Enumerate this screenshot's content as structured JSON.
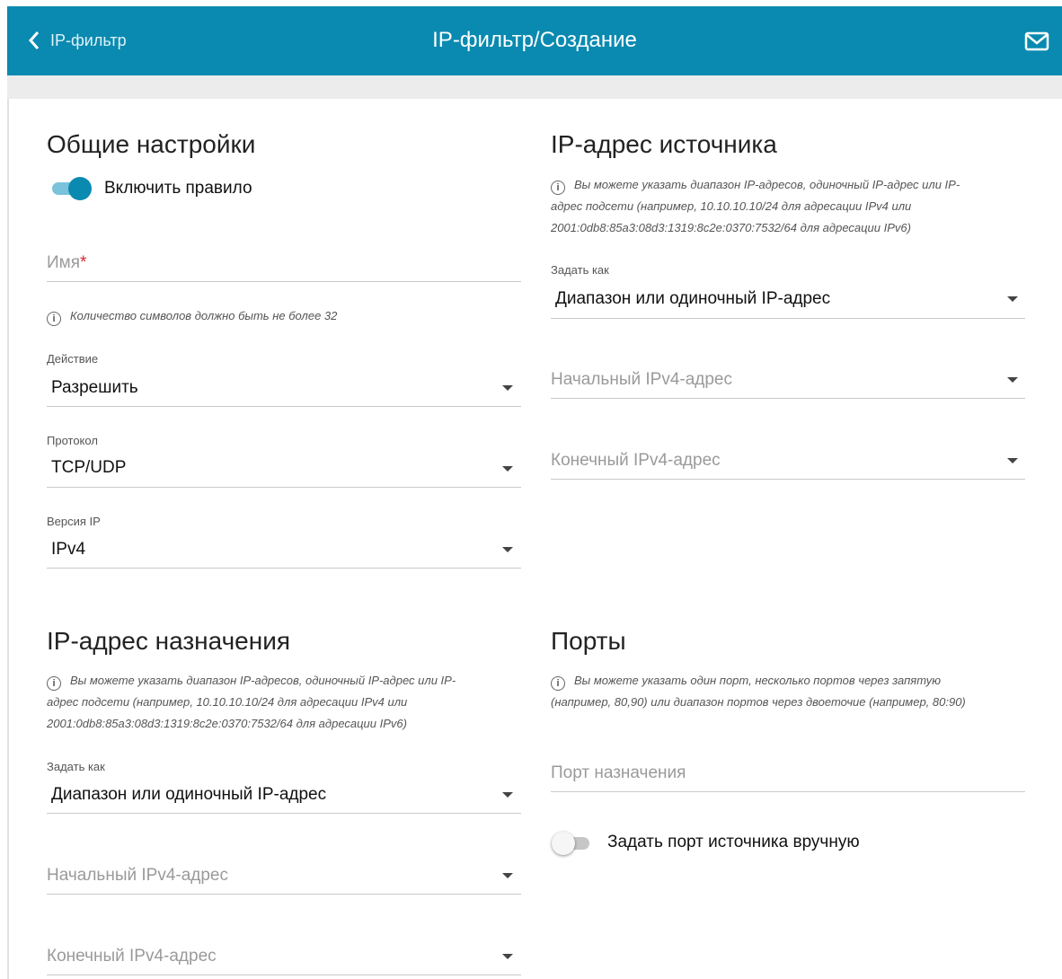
{
  "header": {
    "back_label": "IP-фильтр",
    "title": "IP-фильтр/Создание"
  },
  "general": {
    "title": "Общие настройки",
    "enable_rule_label": "Включить правило",
    "enable_rule_on": true,
    "name_label": "Имя",
    "name_required": "*",
    "name_hint": "Количество символов должно быть не более 32",
    "action_label": "Действие",
    "action_value": "Разрешить",
    "protocol_label": "Протокол",
    "protocol_value": "TCP/UDP",
    "ip_version_label": "Версия IP",
    "ip_version_value": "IPv4"
  },
  "source": {
    "title": "IP-адрес источника",
    "hint_lines": [
      "Вы можете указать диапазон IP-адресов, одиночный IP-адрес или IP-",
      "адрес подсети (например, 10.10.10.10/24 для адресации IPv4 или",
      "2001:0db8:85a3:08d3:1319:8c2e:0370:7532/64 для адресации IPv6)"
    ],
    "set_as_label": "Задать как",
    "set_as_value": "Диапазон или одиночный IP-адрес",
    "start_placeholder": "Начальный IPv4-адрес",
    "end_placeholder": "Конечный IPv4-адрес"
  },
  "destination": {
    "title": "IP-адрес назначения",
    "hint_lines": [
      "Вы можете указать диапазон IP-адресов, одиночный IP-адрес или IP-",
      "адрес подсети (например, 10.10.10.10/24 для адресации IPv4 или",
      "2001:0db8:85a3:08d3:1319:8c2e:0370:7532/64 для адресации IPv6)"
    ],
    "set_as_label": "Задать как",
    "set_as_value": "Диапазон или одиночный IP-адрес",
    "start_placeholder": "Начальный IPv4-адрес",
    "end_placeholder": "Конечный IPv4-адрес"
  },
  "ports": {
    "title": "Порты",
    "hint_lines": [
      "Вы можете указать один порт, несколько портов через запятую",
      "(например, 80,90) или диапазон портов через двоеточие (например, 80:90)"
    ],
    "dest_port_placeholder": "Порт назначения",
    "manual_source_label": "Задать порт источника вручную",
    "manual_source_on": false
  },
  "colors": {
    "header_bg": "#0a8ab0",
    "accent": "#0a8ab0",
    "required": "#d9262c"
  }
}
